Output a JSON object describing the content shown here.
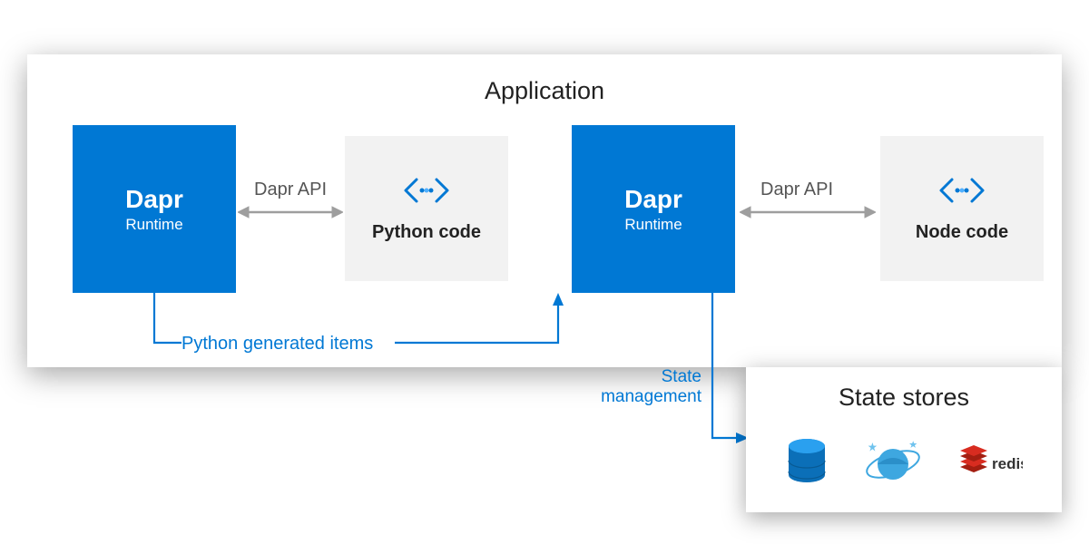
{
  "application": {
    "title": "Application",
    "dapr1": {
      "title": "Dapr",
      "subtitle": "Runtime"
    },
    "dapr2": {
      "title": "Dapr",
      "subtitle": "Runtime"
    },
    "code1": {
      "label": "Python code"
    },
    "code2": {
      "label": "Node code"
    },
    "api1": "Dapr API",
    "api2": "Dapr API",
    "connector_label": "Python generated items"
  },
  "state": {
    "mgmt_label": "State management",
    "box_title": "State stores",
    "stores": [
      "database",
      "cosmos",
      "redis"
    ]
  },
  "colors": {
    "dapr_blue": "#0078d4",
    "gray_box": "#f2f2f2",
    "arrow_gray": "#9e9e9e"
  }
}
